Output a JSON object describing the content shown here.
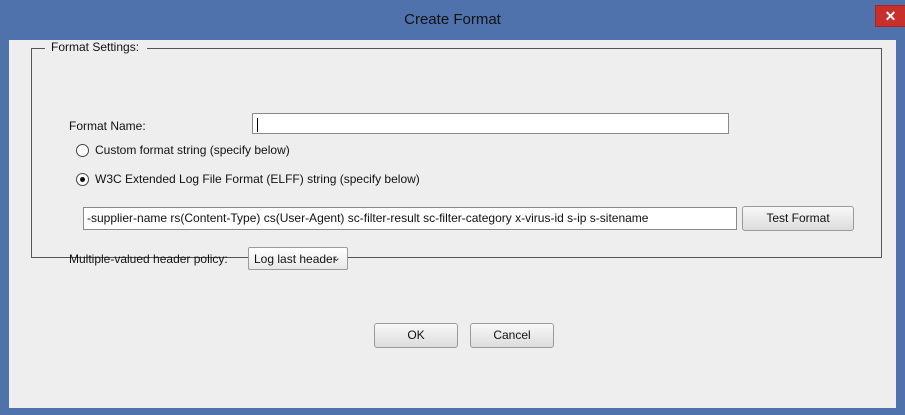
{
  "window": {
    "title": "Create Format",
    "close_glyph": "✕"
  },
  "group": {
    "legend": "Format Settings:"
  },
  "format_name": {
    "label": "Format Name:",
    "value": ""
  },
  "options": {
    "custom_label": "Custom format string (specify below)",
    "w3c_label": "W3C Extended Log File Format (ELFF) string (specify below)",
    "selected": "w3c"
  },
  "format_string": {
    "value": "-supplier-name rs(Content-Type) cs(User-Agent) sc-filter-result sc-filter-category x-virus-id s-ip s-sitename"
  },
  "test_button": {
    "label": "Test Format"
  },
  "header_policy": {
    "label": "Multiple-valued header policy:",
    "value": "Log last header",
    "icon": "chevron-down-icon"
  },
  "footer": {
    "ok_label": "OK",
    "cancel_label": "Cancel"
  }
}
